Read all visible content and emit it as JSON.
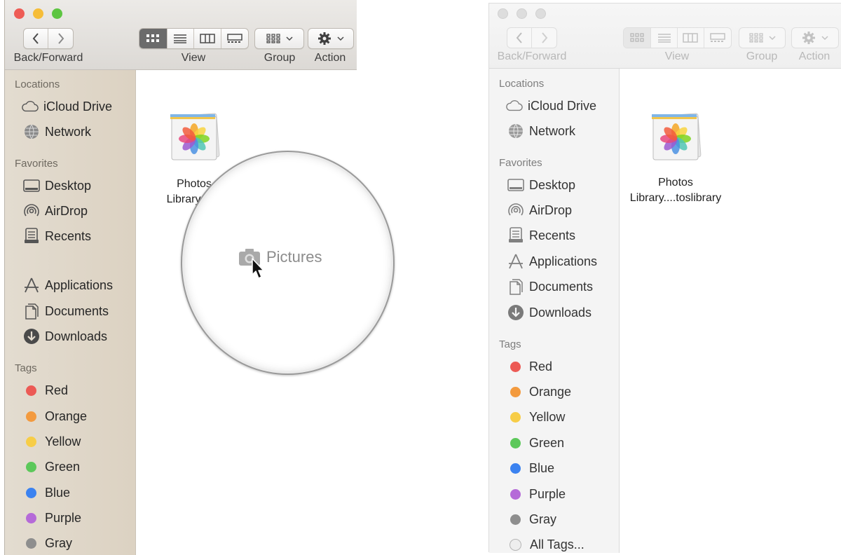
{
  "toolbar": {
    "back_forward_label": "Back/Forward",
    "view_label": "View",
    "group_label": "Group",
    "action_label": "Action"
  },
  "sidebar": {
    "locations_title": "Locations",
    "locations": [
      {
        "label": "iCloud Drive",
        "icon": "cloud-icon"
      },
      {
        "label": "Network",
        "icon": "globe-icon"
      }
    ],
    "favorites_title": "Favorites",
    "favorites": [
      {
        "label": "Desktop",
        "icon": "desktop-icon"
      },
      {
        "label": "AirDrop",
        "icon": "airdrop-icon"
      },
      {
        "label": "Recents",
        "icon": "recents-icon"
      },
      {
        "label": "Applications",
        "icon": "applications-icon"
      },
      {
        "label": "Documents",
        "icon": "documents-icon"
      },
      {
        "label": "Downloads",
        "icon": "downloads-icon"
      }
    ],
    "tags_title": "Tags",
    "tags": [
      {
        "label": "Red",
        "color": "#ec5a55"
      },
      {
        "label": "Orange",
        "color": "#f39a3e"
      },
      {
        "label": "Yellow",
        "color": "#f7cd47"
      },
      {
        "label": "Green",
        "color": "#5cc85a"
      },
      {
        "label": "Blue",
        "color": "#3b82f0"
      },
      {
        "label": "Purple",
        "color": "#b56ad8"
      },
      {
        "label": "Gray",
        "color": "#8e8e8e"
      }
    ],
    "all_tags_label": "All Tags..."
  },
  "file": {
    "left_line1": "Photos",
    "left_line2": "Library....to",
    "right_line1": "Photos",
    "right_line2": "Library....toslibrary"
  },
  "drag": {
    "label": "Pictures",
    "icon": "camera-icon"
  },
  "colors": {
    "close": "#ee5c55",
    "minimize": "#f6bd38",
    "zoom": "#5dc541",
    "inactive_light": "#dddddd"
  }
}
